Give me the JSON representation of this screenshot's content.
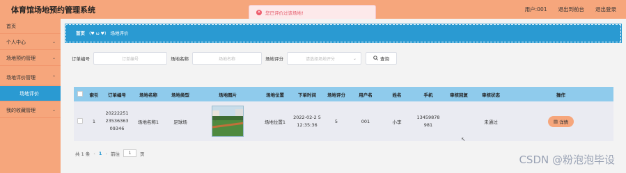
{
  "header": {
    "title": "体育馆场地预约管理系统",
    "user_label": "用户:001",
    "back_label": "退出到前台",
    "logout_label": "退出登录"
  },
  "toast": {
    "message": "您已评价过该场地!"
  },
  "sidebar": {
    "items": [
      {
        "label": "首页",
        "chevron": false
      },
      {
        "label": "个人中心",
        "chevron": true
      },
      {
        "label": "场地预约管理",
        "chevron": true
      },
      {
        "label": "场地评价管理",
        "chevron": true
      },
      {
        "label": "场地评价",
        "chevron": false,
        "active": true
      },
      {
        "label": "我的收藏管理",
        "chevron": true
      }
    ]
  },
  "breadcrumb": {
    "home": "首页",
    "separator": "(♥ ω ♥)",
    "current": "场地评价"
  },
  "search": {
    "order_label": "订单编号",
    "order_placeholder": "订单编号",
    "venue_label": "场地名称",
    "venue_placeholder": "场地名称",
    "rating_label": "场地评分",
    "rating_placeholder": "请选择场地评分",
    "search_button": "查询"
  },
  "table": {
    "headers": [
      "索引",
      "订单编号",
      "场地名称",
      "场地类型",
      "场地图片",
      "场地位置",
      "下单时间",
      "场地评分",
      "用户名",
      "姓名",
      "手机",
      "审核回复",
      "审核状态",
      "操作"
    ],
    "rows": [
      {
        "index": "1",
        "order_no": "20222251 23536363 09346",
        "venue_name": "场地名称1",
        "venue_type": "足球场",
        "venue_location": "场地位置1",
        "order_time": "2022-02-2 5 12:35:36",
        "rating": "5",
        "username": "001",
        "name": "小李",
        "phone": "13459878 981",
        "reply": "",
        "status": "未通过",
        "action": "详情"
      }
    ]
  },
  "pager": {
    "total": "共 1 条",
    "current_page": "1",
    "goto_label": "前往",
    "goto_value": "1",
    "page_suffix": "页"
  },
  "watermark": "CSDN @粉泡泡毕设",
  "colors": {
    "sidebar": "#f6a67c",
    "accent": "#2a9ad2",
    "table_header": "#8fcbec",
    "row_bg": "#eaebf2"
  }
}
